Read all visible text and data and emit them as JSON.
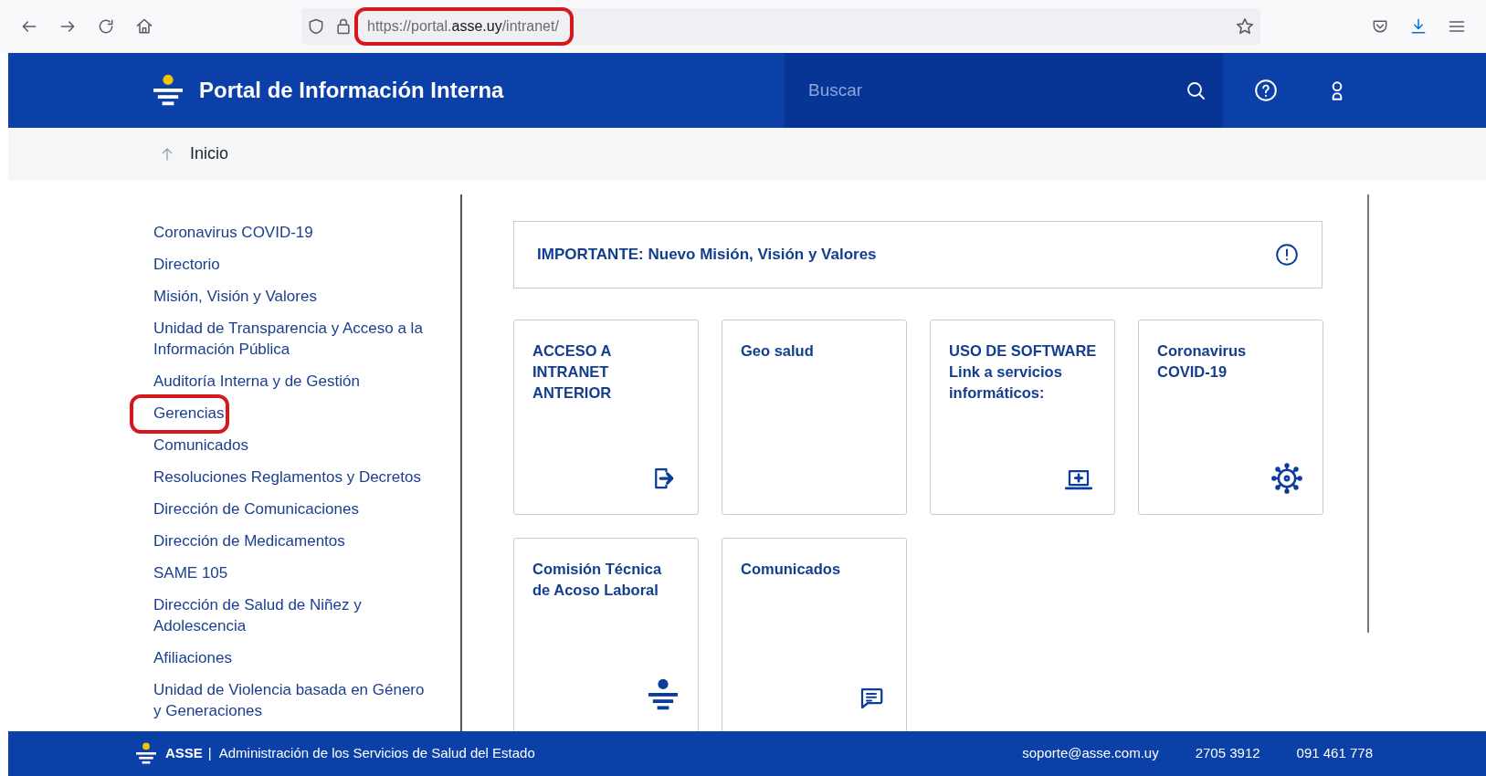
{
  "browser": {
    "url": "https://portal.**asse.uy**/intranet/",
    "url_annotated": true
  },
  "header": {
    "title": "Portal de Información Interna",
    "search": {
      "placeholder": "Buscar"
    }
  },
  "breadcrumb": {
    "label": "Inicio"
  },
  "sidebar": {
    "items": [
      {
        "lines": [
          "Coronavirus COVID-19"
        ],
        "annotated": false
      },
      {
        "lines": [
          "Directorio"
        ],
        "annotated": false
      },
      {
        "lines": [
          "Misión, Visión y Valores"
        ],
        "annotated": false
      },
      {
        "lines": [
          "Unidad de Transparencia y Acceso a la",
          "Información Pública"
        ],
        "annotated": false
      },
      {
        "lines": [
          "Auditoría Interna y de Gestión"
        ],
        "annotated": false
      },
      {
        "lines": [
          "Gerencias"
        ],
        "annotated": true
      },
      {
        "lines": [
          "Comunicados"
        ],
        "annotated": false
      },
      {
        "lines": [
          "Resoluciones Reglamentos y Decretos"
        ],
        "annotated": false
      },
      {
        "lines": [
          "Dirección de Comunicaciones"
        ],
        "annotated": false
      },
      {
        "lines": [
          "Dirección de Medicamentos"
        ],
        "annotated": false
      },
      {
        "lines": [
          "SAME 105"
        ],
        "annotated": false
      },
      {
        "lines": [
          "Dirección de Salud de Niñez y",
          "Adolescencia"
        ],
        "annotated": false
      },
      {
        "lines": [
          "Afiliaciones"
        ],
        "annotated": false
      },
      {
        "lines": [
          "Unidad de Violencia basada en Género",
          "y Generaciones"
        ],
        "annotated": false
      }
    ]
  },
  "notice": {
    "text": "IMPORTANTE: Nuevo Misión, Visión y Valores"
  },
  "tiles": [
    {
      "lines": [
        "ACCESO A",
        "INTRANET",
        "ANTERIOR"
      ],
      "kind": "exit"
    },
    {
      "lines": [
        "Geo salud"
      ],
      "kind": "plain"
    },
    {
      "lines": [
        "USO DE SOFTWARE",
        "Link a servicios",
        "informáticos:"
      ],
      "kind": "laptop"
    },
    {
      "lines": [
        "Coronavirus",
        "COVID-19"
      ],
      "kind": "virus"
    },
    {
      "lines": [
        "Comisión Técnica",
        "de Acoso Laboral"
      ],
      "kind": "logo"
    },
    {
      "lines": [
        "Comunicados"
      ],
      "kind": "chat"
    }
  ],
  "footer": {
    "brand": "ASSE",
    "separator": "|",
    "org": "Administración de los Servicios de Salud del Estado",
    "email": "soporte@asse.com.uy",
    "phones": [
      "2705 3912",
      "091 461 778"
    ]
  }
}
